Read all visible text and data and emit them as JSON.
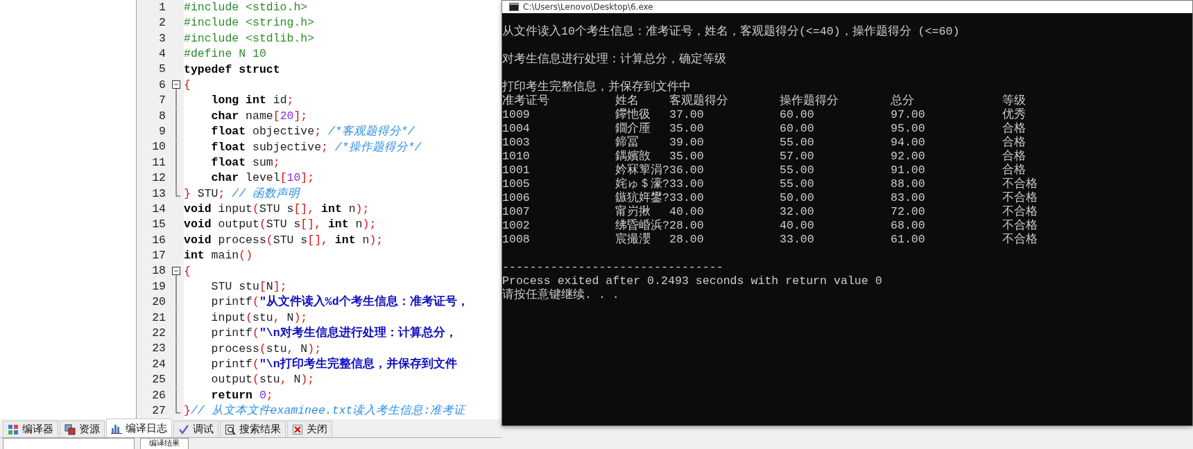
{
  "editor": {
    "lines": [
      {
        "number": "1",
        "kind": "none",
        "tokens": [
          {
            "kind": "pp",
            "t": "#include <stdio.h>"
          }
        ]
      },
      {
        "number": "2",
        "kind": "none",
        "tokens": [
          {
            "kind": "pp",
            "t": "#include <string.h>"
          }
        ]
      },
      {
        "number": "3",
        "kind": "none",
        "tokens": [
          {
            "kind": "pp",
            "t": "#include <stdlib.h>"
          }
        ]
      },
      {
        "number": "4",
        "kind": "none",
        "tokens": [
          {
            "kind": "pp",
            "t": "#define N 10"
          }
        ]
      },
      {
        "number": "5",
        "kind": "none",
        "tokens": [
          {
            "kind": "kw",
            "t": "typedef struct"
          }
        ]
      },
      {
        "number": "6",
        "kind": "start",
        "tokens": [
          {
            "kind": "sym",
            "t": "{"
          }
        ]
      },
      {
        "number": "7",
        "kind": "line",
        "tokens": [
          {
            "kind": "kw",
            "t": "    long int"
          },
          {
            "kind": "id",
            "t": " id"
          },
          {
            "kind": "sym",
            "t": ";"
          }
        ]
      },
      {
        "number": "8",
        "kind": "line",
        "tokens": [
          {
            "kind": "kw",
            "t": "    char"
          },
          {
            "kind": "id",
            "t": " name"
          },
          {
            "kind": "sym",
            "t": "["
          },
          {
            "kind": "num",
            "t": "20"
          },
          {
            "kind": "sym",
            "t": "];"
          }
        ]
      },
      {
        "number": "9",
        "kind": "line",
        "tokens": [
          {
            "kind": "kw",
            "t": "    float"
          },
          {
            "kind": "id",
            "t": " objective"
          },
          {
            "kind": "sym",
            "t": ";"
          },
          {
            "kind": "cmt",
            "t": " /*客观题得分*/"
          }
        ]
      },
      {
        "number": "10",
        "kind": "line",
        "tokens": [
          {
            "kind": "kw",
            "t": "    float"
          },
          {
            "kind": "id",
            "t": " subjective"
          },
          {
            "kind": "sym",
            "t": ";"
          },
          {
            "kind": "cmt",
            "t": " /*操作题得分*/"
          }
        ]
      },
      {
        "number": "11",
        "kind": "line",
        "tokens": [
          {
            "kind": "kw",
            "t": "    float"
          },
          {
            "kind": "id",
            "t": " sum"
          },
          {
            "kind": "sym",
            "t": ";"
          }
        ]
      },
      {
        "number": "12",
        "kind": "line",
        "tokens": [
          {
            "kind": "kw",
            "t": "    char"
          },
          {
            "kind": "id",
            "t": " level"
          },
          {
            "kind": "sym",
            "t": "["
          },
          {
            "kind": "num",
            "t": "10"
          },
          {
            "kind": "sym",
            "t": "];"
          }
        ]
      },
      {
        "number": "13",
        "kind": "end",
        "tokens": [
          {
            "kind": "sym",
            "t": "}"
          },
          {
            "kind": "id",
            "t": " STU"
          },
          {
            "kind": "sym",
            "t": ";"
          },
          {
            "kind": "cmt",
            "t": " // 函数声明"
          }
        ]
      },
      {
        "number": "14",
        "kind": "none",
        "tokens": [
          {
            "kind": "kw",
            "t": "void"
          },
          {
            "kind": "id",
            "t": " input"
          },
          {
            "kind": "sym",
            "t": "("
          },
          {
            "kind": "id",
            "t": "STU s"
          },
          {
            "kind": "sym",
            "t": "[],"
          },
          {
            "kind": "kw",
            "t": " int"
          },
          {
            "kind": "id",
            "t": " n"
          },
          {
            "kind": "sym",
            "t": ");"
          }
        ]
      },
      {
        "number": "15",
        "kind": "none",
        "tokens": [
          {
            "kind": "kw",
            "t": "void"
          },
          {
            "kind": "id",
            "t": " output"
          },
          {
            "kind": "sym",
            "t": "("
          },
          {
            "kind": "id",
            "t": "STU s"
          },
          {
            "kind": "sym",
            "t": "[],"
          },
          {
            "kind": "kw",
            "t": " int"
          },
          {
            "kind": "id",
            "t": " n"
          },
          {
            "kind": "sym",
            "t": ");"
          }
        ]
      },
      {
        "number": "16",
        "kind": "none",
        "tokens": [
          {
            "kind": "kw",
            "t": "void"
          },
          {
            "kind": "id",
            "t": " process"
          },
          {
            "kind": "sym",
            "t": "("
          },
          {
            "kind": "id",
            "t": "STU s"
          },
          {
            "kind": "sym",
            "t": "[],"
          },
          {
            "kind": "kw",
            "t": " int"
          },
          {
            "kind": "id",
            "t": " n"
          },
          {
            "kind": "sym",
            "t": ");"
          }
        ]
      },
      {
        "number": "17",
        "kind": "none",
        "tokens": [
          {
            "kind": "kw",
            "t": "int"
          },
          {
            "kind": "id",
            "t": " main"
          },
          {
            "kind": "sym",
            "t": "()"
          }
        ]
      },
      {
        "number": "18",
        "kind": "start",
        "tokens": [
          {
            "kind": "sym",
            "t": "{"
          }
        ]
      },
      {
        "number": "19",
        "kind": "line",
        "tokens": [
          {
            "kind": "id",
            "t": "    STU stu"
          },
          {
            "kind": "sym",
            "t": "["
          },
          {
            "kind": "id",
            "t": "N"
          },
          {
            "kind": "sym",
            "t": "];"
          }
        ]
      },
      {
        "number": "20",
        "kind": "line",
        "tokens": [
          {
            "kind": "id",
            "t": "    printf"
          },
          {
            "kind": "sym",
            "t": "("
          },
          {
            "kind": "str",
            "t": "\"从文件读入%d个考生信息：准考证号，"
          }
        ]
      },
      {
        "number": "21",
        "kind": "line",
        "tokens": [
          {
            "kind": "id",
            "t": "    input"
          },
          {
            "kind": "sym",
            "t": "("
          },
          {
            "kind": "id",
            "t": "stu"
          },
          {
            "kind": "sym",
            "t": ","
          },
          {
            "kind": "id",
            "t": " N"
          },
          {
            "kind": "sym",
            "t": ");"
          }
        ]
      },
      {
        "number": "22",
        "kind": "line",
        "tokens": [
          {
            "kind": "id",
            "t": "    printf"
          },
          {
            "kind": "sym",
            "t": "("
          },
          {
            "kind": "str",
            "t": "\"\\n对考生信息进行处理：计算总分，"
          }
        ]
      },
      {
        "number": "23",
        "kind": "line",
        "tokens": [
          {
            "kind": "id",
            "t": "    process"
          },
          {
            "kind": "sym",
            "t": "("
          },
          {
            "kind": "id",
            "t": "stu"
          },
          {
            "kind": "sym",
            "t": ","
          },
          {
            "kind": "id",
            "t": " N"
          },
          {
            "kind": "sym",
            "t": ");"
          }
        ]
      },
      {
        "number": "24",
        "kind": "line",
        "tokens": [
          {
            "kind": "id",
            "t": "    printf"
          },
          {
            "kind": "sym",
            "t": "("
          },
          {
            "kind": "str",
            "t": "\"\\n打印考生完整信息，并保存到文件"
          }
        ]
      },
      {
        "number": "25",
        "kind": "line",
        "tokens": [
          {
            "kind": "id",
            "t": "    output"
          },
          {
            "kind": "sym",
            "t": "("
          },
          {
            "kind": "id",
            "t": "stu"
          },
          {
            "kind": "sym",
            "t": ","
          },
          {
            "kind": "id",
            "t": " N"
          },
          {
            "kind": "sym",
            "t": ");"
          }
        ]
      },
      {
        "number": "26",
        "kind": "line",
        "tokens": [
          {
            "kind": "kw",
            "t": "    return"
          },
          {
            "kind": "num",
            "t": " 0"
          },
          {
            "kind": "sym",
            "t": ";"
          }
        ]
      },
      {
        "number": "27",
        "kind": "end",
        "tokens": [
          {
            "kind": "sym",
            "t": "}"
          },
          {
            "kind": "cmt",
            "t": "// 从文本文件examinee.txt读入考生信息:准考证"
          }
        ]
      }
    ]
  },
  "bottom_tabs": [
    {
      "label": "编译器",
      "selected": false
    },
    {
      "label": "资源",
      "selected": false
    },
    {
      "label": "编译日志",
      "selected": true
    },
    {
      "label": "调试",
      "selected": false
    },
    {
      "label": "搜索结果",
      "selected": false
    },
    {
      "label": "关闭",
      "selected": false
    }
  ],
  "output_panel": {
    "label": "编译结果"
  },
  "console": {
    "title": "C:\\Users\\Lenovo\\Desktop\\6.exe",
    "intro_lines": [
      "从文件读入10个考生信息：准考证号，姓名，客观题得分(<=40)，操作题得分 (<=60)",
      "对考生信息进行处理：计算总分，确定等级",
      "打印考生完整信息，并保存到文件中"
    ],
    "columns": [
      "准考证号",
      "姓名",
      "客观题得分",
      "操作题得分",
      "总分",
      "等级"
    ],
    "rows": [
      {
        "id": "1009",
        "name": "鑻忚彶",
        "objective": "37.00",
        "subjective": "60.00",
        "total": "97.00",
        "level": "优秀"
      },
      {
        "id": "1004",
        "name": "鐗介厜",
        "objective": "35.00",
        "subjective": "60.00",
        "total": "95.00",
        "level": "合格"
      },
      {
        "id": "1003",
        "name": "鍗冨",
        "objective": "39.00",
        "subjective": "55.00",
        "total": "94.00",
        "level": "合格"
      },
      {
        "id": "1010",
        "name": "鍝嬪敨",
        "objective": "35.00",
        "subjective": "57.00",
        "total": "92.00",
        "level": "合格"
      },
      {
        "id": "1001",
        "name": "妗冧箰涓?",
        "objective": "36.00",
        "subjective": "55.00",
        "total": "91.00",
        "level": "合格"
      },
      {
        "id": "1005",
        "name": "姹ゅ＄濠?",
        "objective": "33.00",
        "subjective": "55.00",
        "total": "88.00",
        "level": "不合格"
      },
      {
        "id": "1006",
        "name": "鏃犺姩鐢?",
        "objective": "33.00",
        "subjective": "50.00",
        "total": "83.00",
        "level": "不合格"
      },
      {
        "id": "1007",
        "name": "甯岃揪",
        "objective": "40.00",
        "subjective": "32.00",
        "total": "72.00",
        "level": "不合格"
      },
      {
        "id": "1002",
        "name": "绋昏崏浜?",
        "objective": "28.00",
        "subjective": "40.00",
        "total": "68.00",
        "level": "不合格"
      },
      {
        "id": "1008",
        "name": "宸撮瀴",
        "objective": "28.00",
        "subjective": "33.00",
        "total": "61.00",
        "level": "不合格"
      }
    ],
    "separator": "--------------------------------",
    "exit_message": "Process exited after 0.2493 seconds with return value 0",
    "prompt": "请按任意键继续. . ."
  }
}
